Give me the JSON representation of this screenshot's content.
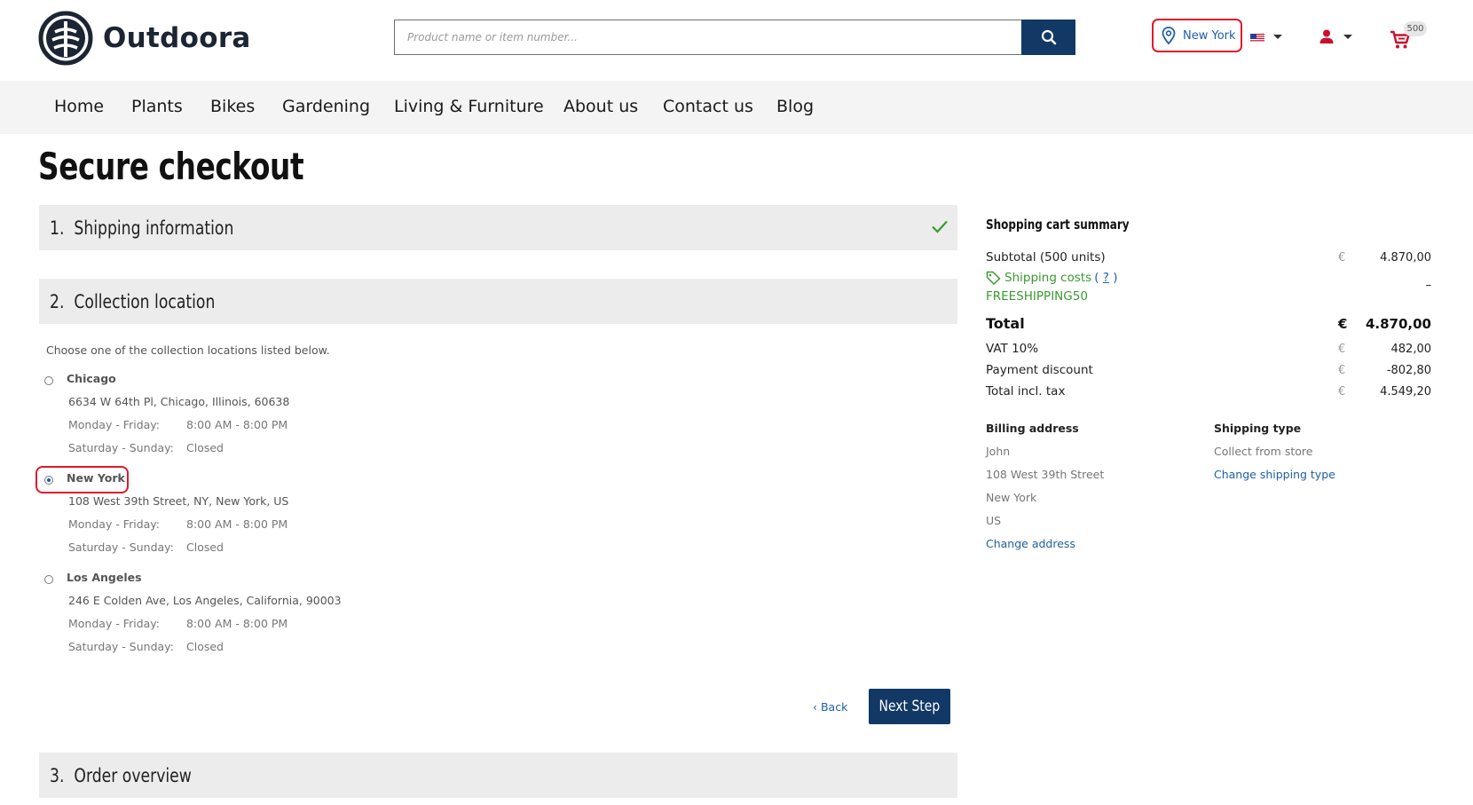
{
  "header": {
    "brand": "Outdoora",
    "search_placeholder": "Product name or item number...",
    "location_label": "New York",
    "cart_count": "500",
    "flag_country": "us"
  },
  "nav": {
    "items": [
      "Home",
      "Plants",
      "Bikes",
      "Gardening",
      "Living & Furniture",
      "About us",
      "Contact us",
      "Blog"
    ]
  },
  "page": {
    "title": "Secure checkout"
  },
  "steps": [
    {
      "number": "1.",
      "title": "Shipping information",
      "status": "complete"
    },
    {
      "number": "2.",
      "title": "Collection location",
      "status": "active"
    },
    {
      "number": "3.",
      "title": "Order overview",
      "status": "pending"
    }
  ],
  "collection": {
    "intro": "Choose one of the collection locations listed below.",
    "selected": "New York",
    "locations": [
      {
        "name": "Chicago",
        "address": "6634 W 64th Pl, Chicago, Illinois, 60638",
        "weekday_label": "Monday - Friday:",
        "weekday_hours": "8:00 AM - 8:00 PM",
        "weekend_label": "Saturday - Sunday:",
        "weekend_hours": "Closed"
      },
      {
        "name": "New York",
        "address": "108 West 39th Street, NY, New York, US",
        "weekday_label": "Monday - Friday:",
        "weekday_hours": "8:00 AM - 8:00 PM",
        "weekend_label": "Saturday - Sunday:",
        "weekend_hours": "Closed"
      },
      {
        "name": "Los Angeles",
        "address": "246 E Colden Ave, Los Angeles, California, 90003",
        "weekday_label": "Monday - Friday:",
        "weekday_hours": "8:00 AM - 8:00 PM",
        "weekend_label": "Saturday - Sunday:",
        "weekend_hours": "Closed"
      }
    ],
    "back_label": "‹ Back",
    "next_label": "Next Step"
  },
  "summary": {
    "title": "Shopping cart summary",
    "subtotal_label": "Subtotal (500 units)",
    "subtotal_currency": "€",
    "subtotal_value": "4.870,00",
    "shipping_label": "Shipping costs",
    "shipping_help": "?",
    "shipping_value": "–",
    "coupon_code": "FREESHIPPING50",
    "total_label": "Total",
    "total_currency": "€",
    "total_value": "4.870,00",
    "vat_label": "VAT 10%",
    "vat_currency": "€",
    "vat_value": "482,00",
    "discount_label": "Payment discount",
    "discount_currency": "€",
    "discount_value": "-802,80",
    "incl_tax_label": "Total incl. tax",
    "incl_tax_currency": "€",
    "incl_tax_value": "4.549,20",
    "billing": {
      "heading": "Billing address",
      "lines": [
        "John",
        "108 West 39th Street",
        "New York",
        "US"
      ],
      "change_label": "Change address"
    },
    "shipping_type": {
      "heading": "Shipping type",
      "value": "Collect from store",
      "change_label": "Change shipping type"
    }
  },
  "colors": {
    "brand_navy": "#123866",
    "link_blue": "#1f5fa8",
    "success_green": "#3a9a2f",
    "highlight_red": "#e0192d",
    "step_bg": "#ececec"
  }
}
